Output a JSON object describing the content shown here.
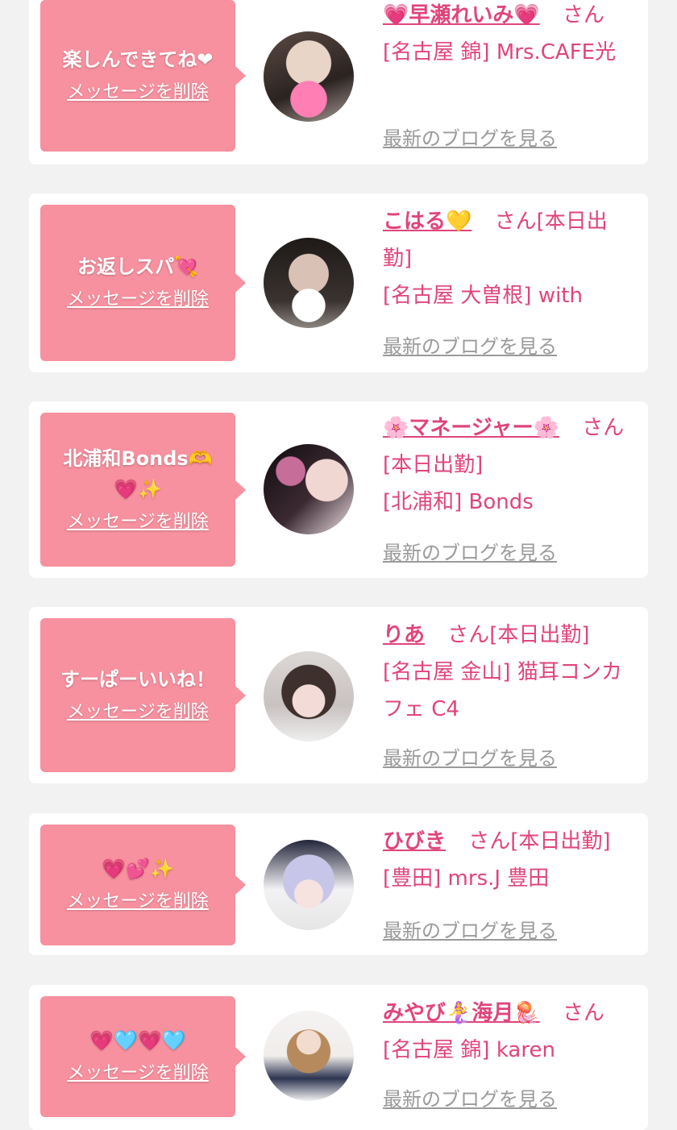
{
  "cards": [
    {
      "message": "楽しんできてね❤",
      "delete_label": "メッセージを削除",
      "name": "💗早瀬れいみ💗",
      "san": "さん",
      "shop": "[名古屋 錦] Mrs.CAFE光",
      "blog_label": "最新のブログを見る"
    },
    {
      "message": "お返しスパ💘",
      "delete_label": "メッセージを削除",
      "name": "こはる💛",
      "san": "さん[本日出勤]",
      "shop": "[名古屋 大曽根] with",
      "blog_label": "最新のブログを見る"
    },
    {
      "message": "北浦和Bonds🫶💗✨",
      "delete_label": "メッセージを削除",
      "name": "🌸マネージャー🌸",
      "san": "さん[本日出勤]",
      "shop": "[北浦和] Bonds",
      "blog_label": "最新のブログを見る"
    },
    {
      "message": "すーぱーいいね！",
      "delete_label": "メッセージを削除",
      "name": "りあ",
      "san": "さん[本日出勤]",
      "shop": "[名古屋 金山] 猫耳コンカフェ C4",
      "blog_label": "最新のブログを見る"
    },
    {
      "message": "💗💕✨",
      "delete_label": "メッセージを削除",
      "name": "ひびき",
      "san": "さん[本日出勤]",
      "shop": "[豊田] mrs.J 豊田",
      "blog_label": "最新のブログを見る"
    },
    {
      "message": "💗🩵💗🩵",
      "delete_label": "メッセージを削除",
      "name": "みやび🧜‍♀️海月🪼",
      "san": "さん",
      "shop": "[名古屋 錦] karen",
      "blog_label": "最新のブログを見る"
    }
  ]
}
